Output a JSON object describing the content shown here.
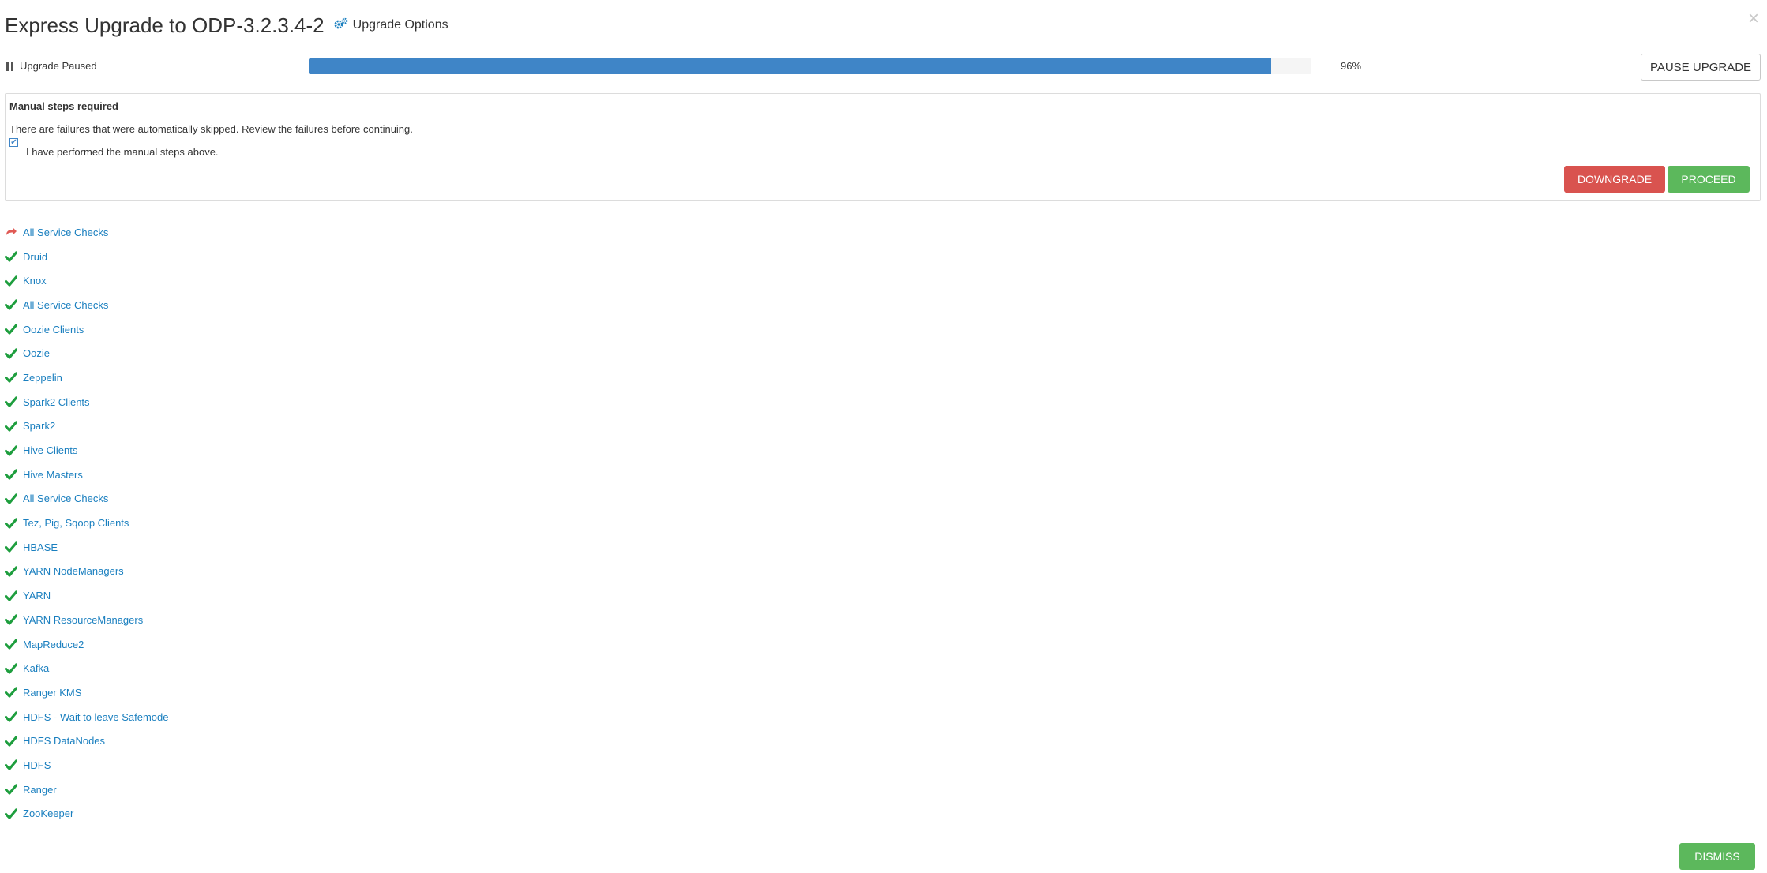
{
  "modal": {
    "title": "Express Upgrade to ODP-3.2.3.4-2",
    "options_label": "Upgrade Options",
    "close_glyph": "×"
  },
  "progress": {
    "status": "Upgrade Paused",
    "percent": 96,
    "percent_label": "96%",
    "pause_label": "PAUSE UPGRADE",
    "bar_color": "#3f85c7"
  },
  "manual_steps": {
    "title": "Manual steps required",
    "message": "There are failures that were automatically skipped. Review the failures before continuing.",
    "confirm_label": "I have performed the manual steps above.",
    "confirm_checked": true,
    "downgrade_label": "DOWNGRADE",
    "proceed_label": "PROCEED"
  },
  "tasks": [
    {
      "label": "All Service Checks",
      "status": "skipped"
    },
    {
      "label": "Druid",
      "status": "done"
    },
    {
      "label": "Knox",
      "status": "done"
    },
    {
      "label": "All Service Checks",
      "status": "done"
    },
    {
      "label": "Oozie Clients",
      "status": "done"
    },
    {
      "label": "Oozie",
      "status": "done"
    },
    {
      "label": "Zeppelin",
      "status": "done"
    },
    {
      "label": "Spark2 Clients",
      "status": "done"
    },
    {
      "label": "Spark2",
      "status": "done"
    },
    {
      "label": "Hive Clients",
      "status": "done"
    },
    {
      "label": "Hive Masters",
      "status": "done"
    },
    {
      "label": "All Service Checks",
      "status": "done"
    },
    {
      "label": "Tez, Pig, Sqoop Clients",
      "status": "done"
    },
    {
      "label": "HBASE",
      "status": "done"
    },
    {
      "label": "YARN NodeManagers",
      "status": "done"
    },
    {
      "label": "YARN",
      "status": "done"
    },
    {
      "label": "YARN ResourceManagers",
      "status": "done"
    },
    {
      "label": "MapReduce2",
      "status": "done"
    },
    {
      "label": "Kafka",
      "status": "done"
    },
    {
      "label": "Ranger KMS",
      "status": "done"
    },
    {
      "label": "HDFS - Wait to leave Safemode",
      "status": "done"
    },
    {
      "label": "HDFS DataNodes",
      "status": "done"
    },
    {
      "label": "HDFS",
      "status": "done"
    },
    {
      "label": "Ranger",
      "status": "done"
    },
    {
      "label": "ZooKeeper",
      "status": "done"
    }
  ],
  "footer": {
    "dismiss_label": "DISMISS"
  },
  "colors": {
    "link": "#1a7fbf",
    "check": "#1e9e3e",
    "skip_arrow": "#e05a55",
    "danger": "#d9534f",
    "success": "#5cb85c"
  }
}
